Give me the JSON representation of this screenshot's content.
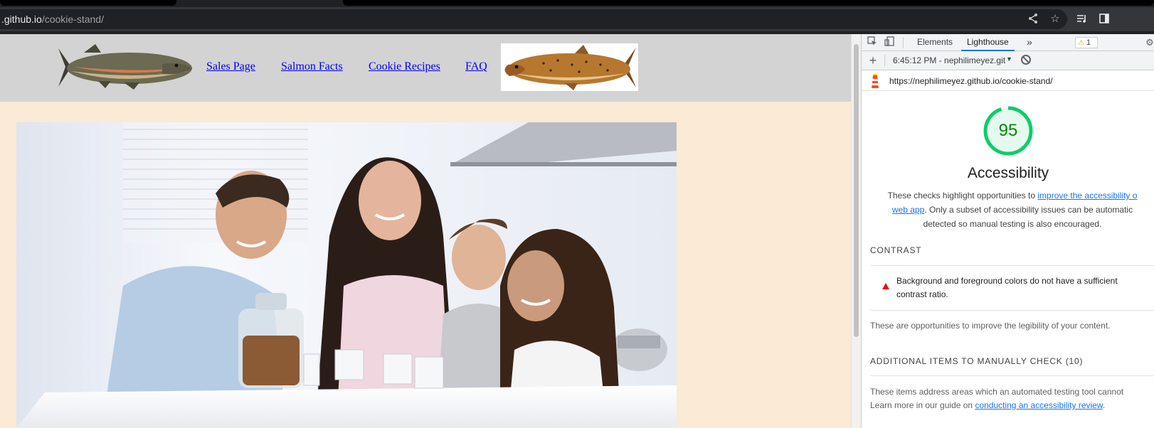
{
  "browser": {
    "url_host": ".github.io",
    "url_path": "/cookie-stand/",
    "icons": [
      "share-icon",
      "bookmark-star-icon",
      "reading-list-icon",
      "side-panel-icon"
    ]
  },
  "site": {
    "nav": [
      {
        "label": "Sales Page"
      },
      {
        "label": "Salmon Facts"
      },
      {
        "label": "Cookie Recipes"
      },
      {
        "label": "FAQ"
      }
    ],
    "colors": {
      "header_bg": "#d3d3d3",
      "page_bg": "#fbead5",
      "link": "#0000ee"
    }
  },
  "devtools": {
    "tabs": [
      {
        "label": "Elements"
      },
      {
        "label": "Lighthouse"
      }
    ],
    "more_tabs": "»",
    "warning_count": "1",
    "report_time": "6:45:12 PM - nephilimeyez.git",
    "report_url": "https://nephilimeyez.github.io/cookie-stand/",
    "score": "95",
    "score_fraction": 0.95,
    "score_color": "#0cce6b",
    "category_title": "Accessibility",
    "description": {
      "line1_prefix": "These checks highlight opportunities to ",
      "line1_link": "improve the accessibility o",
      "line2_link": "web app",
      "line2_suffix": ". Only a subset of accessibility issues can be automatic",
      "line3": "detected so manual testing is also encouraged."
    },
    "contrast": {
      "title": "CONTRAST",
      "audit_line1": "Background and foreground colors do not have a sufficient",
      "audit_line2": "contrast ratio.",
      "group_desc": "These are opportunities to improve the legibility of your content."
    },
    "manual": {
      "title": "ADDITIONAL ITEMS TO MANUALLY CHECK (10)",
      "desc_line1": "These items address areas which an automated testing tool cannot",
      "desc_line2_prefix": "Learn more in our guide on ",
      "desc_line2_link": "conducting an accessibility review",
      "desc_line2_suffix": "."
    }
  }
}
